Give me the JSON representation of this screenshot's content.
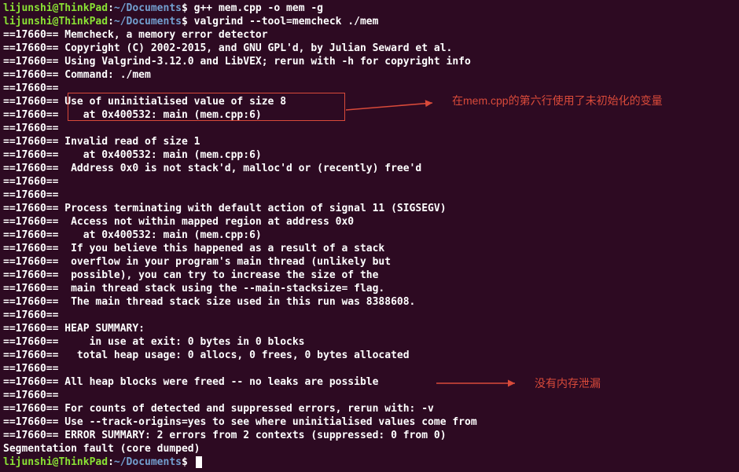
{
  "prompt1": {
    "user": "lijunshi@ThinkPad",
    "sep": ":",
    "path": "~/Documents",
    "dollar": "$ ",
    "cmd": "g++ mem.cpp -o mem -g"
  },
  "prompt2": {
    "user": "lijunshi@ThinkPad",
    "sep": ":",
    "path": "~/Documents",
    "dollar": "$ ",
    "cmd": "valgrind --tool=memcheck ./mem"
  },
  "output": [
    "==17660== Memcheck, a memory error detector",
    "==17660== Copyright (C) 2002-2015, and GNU GPL'd, by Julian Seward et al.",
    "==17660== Using Valgrind-3.12.0 and LibVEX; rerun with -h for copyright info",
    "==17660== Command: ./mem",
    "==17660==",
    "==17660== Use of uninitialised value of size 8",
    "==17660==    at 0x400532: main (mem.cpp:6)",
    "==17660==",
    "==17660== Invalid read of size 1",
    "==17660==    at 0x400532: main (mem.cpp:6)",
    "==17660==  Address 0x0 is not stack'd, malloc'd or (recently) free'd",
    "==17660==",
    "==17660==",
    "==17660== Process terminating with default action of signal 11 (SIGSEGV)",
    "==17660==  Access not within mapped region at address 0x0",
    "==17660==    at 0x400532: main (mem.cpp:6)",
    "==17660==  If you believe this happened as a result of a stack",
    "==17660==  overflow in your program's main thread (unlikely but",
    "==17660==  possible), you can try to increase the size of the",
    "==17660==  main thread stack using the --main-stacksize= flag.",
    "==17660==  The main thread stack size used in this run was 8388608.",
    "==17660==",
    "==17660== HEAP SUMMARY:",
    "==17660==     in use at exit: 0 bytes in 0 blocks",
    "==17660==   total heap usage: 0 allocs, 0 frees, 0 bytes allocated",
    "==17660==",
    "==17660== All heap blocks were freed -- no leaks are possible",
    "==17660==",
    "==17660== For counts of detected and suppressed errors, rerun with: -v",
    "==17660== Use --track-origins=yes to see where uninitialised values come from",
    "==17660== ERROR SUMMARY: 2 errors from 2 contexts (suppressed: 0 from 0)",
    "Segmentation fault (core dumped)"
  ],
  "prompt3": {
    "user": "lijunshi@ThinkPad",
    "sep": ":",
    "path": "~/Documents",
    "dollar": "$ "
  },
  "annotations": {
    "top_text": "在mem.cpp的第六行使用了未初始化的变量",
    "bottom_text": "没有内存泄漏"
  }
}
